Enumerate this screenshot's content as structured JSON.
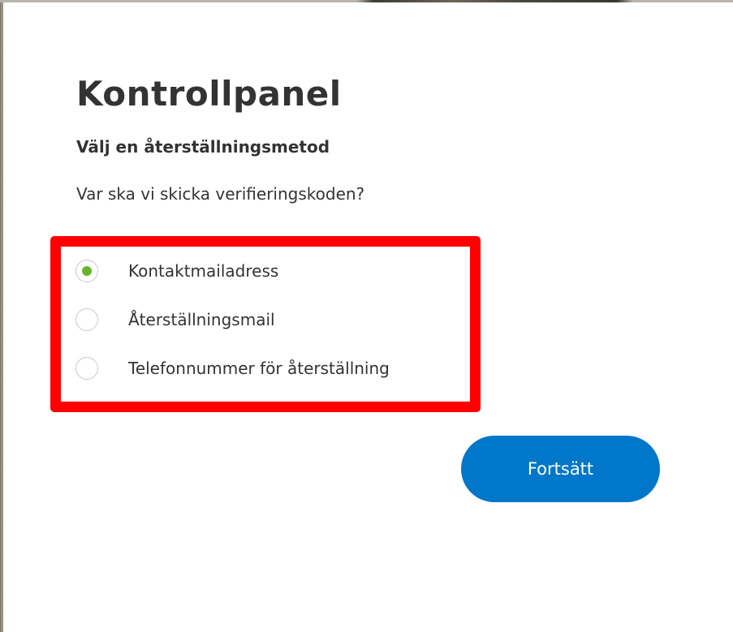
{
  "dialog": {
    "title": "Kontrollpanel",
    "subtitle": "Välj en återställningsmetod",
    "question": "Var ska vi skicka verifieringskoden?",
    "options": [
      {
        "label": "Kontaktmailadress",
        "selected": true
      },
      {
        "label": "Återställningsmail",
        "selected": false
      },
      {
        "label": "Telefonnummer för återställning",
        "selected": false
      }
    ],
    "continue_label": "Fortsätt"
  },
  "colors": {
    "highlight_border": "#ff0000",
    "radio_selected": "#6ab42d",
    "button_background": "#0077c8",
    "text": "#333333"
  }
}
